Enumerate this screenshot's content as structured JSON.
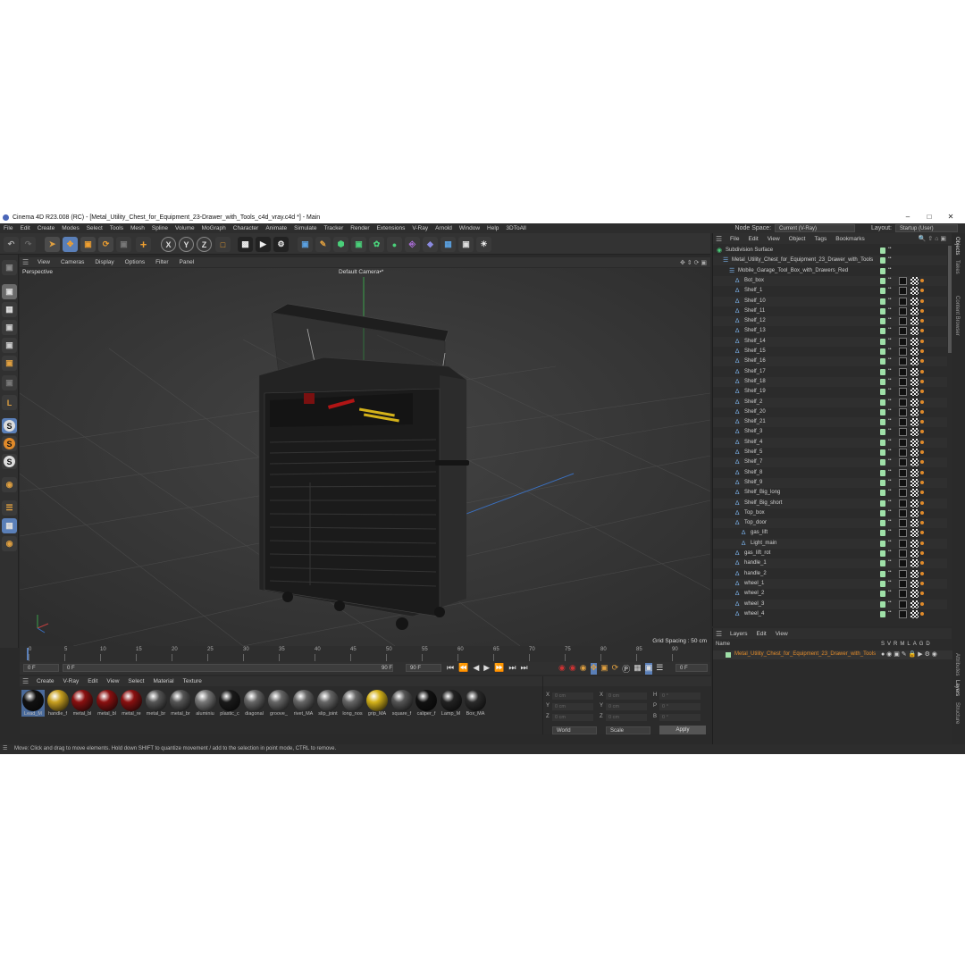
{
  "window": {
    "title": "Cinema 4D R23.008 (RC) - [Metal_Utility_Chest_for_Equipment_23-Drawer_with_Tools_c4d_vray.c4d *] - Main"
  },
  "menu": [
    "File",
    "Edit",
    "Create",
    "Modes",
    "Select",
    "Tools",
    "Mesh",
    "Spline",
    "Volume",
    "MoGraph",
    "Character",
    "Animate",
    "Simulate",
    "Tracker",
    "Render",
    "Extensions",
    "V-Ray",
    "Arnold",
    "Window",
    "Help",
    "3DToAll"
  ],
  "node_space": {
    "label": "Node Space:",
    "value": "Current (V-Ray)"
  },
  "layout": {
    "label": "Layout:",
    "value": "Startup (User)"
  },
  "viewport": {
    "menu": [
      "View",
      "Cameras",
      "Display",
      "Options",
      "Filter",
      "Panel"
    ],
    "view_name": "Perspective",
    "camera": "Default Camera",
    "camera_suffix": "•*",
    "grid_spacing": "Grid Spacing : 50 cm"
  },
  "timeline": {
    "ticks": [
      "0",
      "5",
      "10",
      "15",
      "20",
      "25",
      "30",
      "35",
      "40",
      "45",
      "50",
      "55",
      "60",
      "65",
      "70",
      "75",
      "80",
      "85",
      "90"
    ],
    "current_frame": "0 F",
    "start": "0 F",
    "range_start": "0 F",
    "range_end": "90 F",
    "end": "90 F",
    "frame_field": "0 F"
  },
  "materials": {
    "menu": [
      "Create",
      "V-Ray",
      "Edit",
      "View",
      "Select",
      "Material",
      "Texture"
    ],
    "items": [
      {
        "label": "Lead_M",
        "color": "#111111"
      },
      {
        "label": "handle_f",
        "color": "#c8a020"
      },
      {
        "label": "metal_bl",
        "color": "#8a1010"
      },
      {
        "label": "metal_bl",
        "color": "#8a1010"
      },
      {
        "label": "metal_re",
        "color": "#8a1010"
      },
      {
        "label": "metal_br",
        "color": "#555555"
      },
      {
        "label": "metal_br",
        "color": "#555555"
      },
      {
        "label": "aluminiu",
        "color": "#777777"
      },
      {
        "label": "plastic_c",
        "color": "#1a1a1a"
      },
      {
        "label": "diagonal",
        "color": "#666666"
      },
      {
        "label": "groove_",
        "color": "#666666"
      },
      {
        "label": "rivet_MA",
        "color": "#666666"
      },
      {
        "label": "slip_joint",
        "color": "#666666"
      },
      {
        "label": "long_nos",
        "color": "#666666"
      },
      {
        "label": "grip_MA",
        "color": "#d4b21a"
      },
      {
        "label": "square_f",
        "color": "#555555"
      },
      {
        "label": "caliper_f",
        "color": "#111111"
      },
      {
        "label": "Lamp_M",
        "color": "#222222"
      },
      {
        "label": "Box_MA",
        "color": "#2a2a2a"
      }
    ]
  },
  "coords": {
    "labels": [
      "X",
      "Y",
      "Z"
    ],
    "pos": [
      "0 cm",
      "0 cm",
      "0 cm"
    ],
    "size": [
      "0 cm",
      "0 cm",
      "0 cm"
    ],
    "rot": [
      "0 °",
      "0 °",
      "0 °"
    ],
    "size_labels": [
      "X",
      "Y",
      "Z"
    ],
    "rot_labels": [
      "H",
      "P",
      "B"
    ],
    "mode": "World",
    "scale": "Scale",
    "apply": "Apply"
  },
  "status": "Move: Click and drag to move elements. Hold down SHIFT to quantize movement / add to the selection in point mode, CTRL to remove.",
  "object_manager": {
    "menu": [
      "File",
      "Edit",
      "View",
      "Object",
      "Tags",
      "Bookmarks"
    ],
    "rows": [
      {
        "name": "Subdivision Surface",
        "indent": 0
      },
      {
        "name": "Metal_Utility_Chest_for_Equipment_23_Drawer_with_Tools",
        "indent": 1
      },
      {
        "name": "Mobile_Garage_Tool_Box_with_Drawers_Red",
        "indent": 2
      },
      {
        "name": "Bot_box",
        "indent": 3
      },
      {
        "name": "Shelf_1",
        "indent": 3
      },
      {
        "name": "Shelf_10",
        "indent": 3
      },
      {
        "name": "Shelf_11",
        "indent": 3
      },
      {
        "name": "Shelf_12",
        "indent": 3
      },
      {
        "name": "Shelf_13",
        "indent": 3
      },
      {
        "name": "Shelf_14",
        "indent": 3
      },
      {
        "name": "Shelf_15",
        "indent": 3
      },
      {
        "name": "Shelf_16",
        "indent": 3
      },
      {
        "name": "Shelf_17",
        "indent": 3
      },
      {
        "name": "Shelf_18",
        "indent": 3
      },
      {
        "name": "Shelf_19",
        "indent": 3
      },
      {
        "name": "Shelf_2",
        "indent": 3
      },
      {
        "name": "Shelf_20",
        "indent": 3
      },
      {
        "name": "Shelf_21",
        "indent": 3
      },
      {
        "name": "Shelf_3",
        "indent": 3
      },
      {
        "name": "Shelf_4",
        "indent": 3
      },
      {
        "name": "Shelf_5",
        "indent": 3
      },
      {
        "name": "Shelf_7",
        "indent": 3
      },
      {
        "name": "Shelf_8",
        "indent": 3
      },
      {
        "name": "Shelf_9",
        "indent": 3
      },
      {
        "name": "Shelf_Big_long",
        "indent": 3
      },
      {
        "name": "Shelf_Big_short",
        "indent": 3
      },
      {
        "name": "Top_box",
        "indent": 3
      },
      {
        "name": "Top_door",
        "indent": 3
      },
      {
        "name": "gas_lift",
        "indent": 4
      },
      {
        "name": "Light_main",
        "indent": 4
      },
      {
        "name": "gas_lift_rot",
        "indent": 3
      },
      {
        "name": "handle_1",
        "indent": 3
      },
      {
        "name": "handle_2",
        "indent": 3
      },
      {
        "name": "wheel_1",
        "indent": 3
      },
      {
        "name": "wheel_2",
        "indent": 3
      },
      {
        "name": "wheel_3",
        "indent": 3
      },
      {
        "name": "wheel_4",
        "indent": 3
      }
    ]
  },
  "layers": {
    "menu": [
      "Layers",
      "Edit",
      "View"
    ],
    "col_name": "Name",
    "cols": [
      "S",
      "V",
      "R",
      "M",
      "L",
      "A",
      "G",
      "D"
    ],
    "item": "Metal_Utility_Chest_for_Equipment_23_Drawer_with_Tools",
    "item_color": "#e08a2a"
  },
  "right_tabs": [
    "Objects",
    "Takes",
    "Content Browser",
    "Attributes",
    "Layers",
    "Structure"
  ]
}
